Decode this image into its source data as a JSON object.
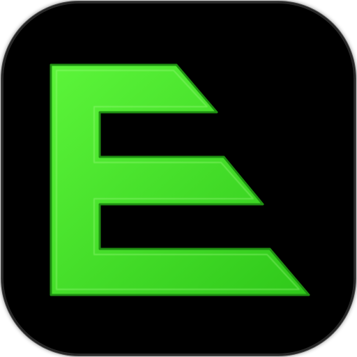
{
  "app_icon": {
    "name": "E app icon",
    "logo_letter": "E",
    "colors": {
      "background": "#000000",
      "letter_fill_light": "#5cf53a",
      "letter_fill_dark": "#2fc81a",
      "letter_edge": "#1f8f12"
    }
  }
}
